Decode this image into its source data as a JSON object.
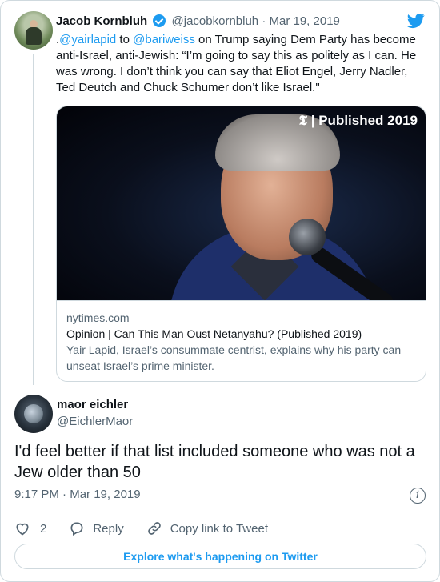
{
  "parent_tweet": {
    "author_name": "Jacob Kornbluh",
    "handle": "@jacobkornbluh",
    "separator": "·",
    "date": "Mar 19, 2019",
    "text_prefix": ".",
    "mention_1": "@yairlapid",
    "text_mid": " to ",
    "mention_2": "@bariweiss",
    "text_body": " on Trump saying Dem Party has become anti-Israel, anti-Jewish: “I’m going to say this as politely as I can. He was wrong. I don’t think you can say that Eliot Engel, Jerry Nadler, Ted Deutch and Chuck Schumer don’t like Israel.\""
  },
  "link_card": {
    "badge_logo": "𝕿",
    "badge_text": "| Published 2019",
    "domain": "nytimes.com",
    "title": "Opinion | Can This Man Oust Netanyahu? (Published 2019)",
    "description": "Yair Lapid, Israel’s consummate centrist, explains why his party can unseat Israel’s prime minister."
  },
  "reply": {
    "author_name": "maor eichler",
    "handle": "@EichlerMaor",
    "text": "I'd feel better if that list included someone who was not a Jew older than 50",
    "time": "9:17 PM",
    "separator": "·",
    "date": "Mar 19, 2019"
  },
  "actions": {
    "like_count": "2",
    "reply_label": "Reply",
    "copy_label": "Copy link to Tweet"
  },
  "explore_label": "Explore what's happening on Twitter",
  "colors": {
    "accent": "#1d9bf0",
    "text": "#0f1419",
    "muted": "#536471",
    "border": "#cfd9de"
  }
}
